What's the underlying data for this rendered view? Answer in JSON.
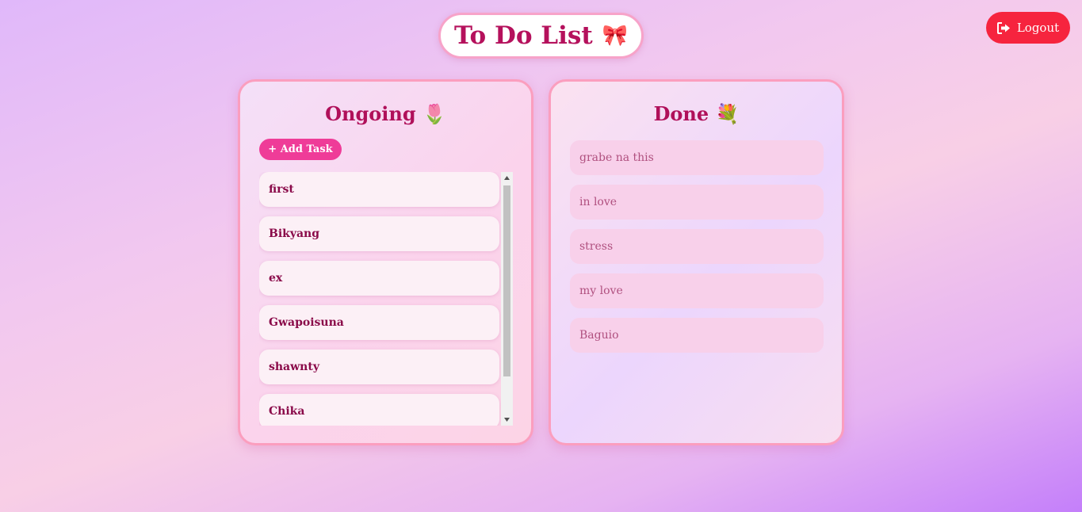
{
  "header": {
    "title": "To Do List",
    "title_emoji": "🎀"
  },
  "logout": {
    "label": "Logout"
  },
  "ongoing": {
    "title": "Ongoing",
    "emoji": "🌷",
    "add_button": "+ Add Task",
    "tasks": [
      "first",
      "Bikyang",
      "ex",
      "Gwapoisuna",
      "shawnty",
      "Chika"
    ]
  },
  "done": {
    "title": "Done",
    "emoji": "💐",
    "tasks": [
      "grabe na this",
      "in love",
      "stress",
      "my love",
      "Baguio"
    ]
  },
  "colors": {
    "accent": "#b5115c",
    "add_button": "#ef3c98",
    "logout": "#f6243e",
    "card_border": "#fb9ebe"
  }
}
